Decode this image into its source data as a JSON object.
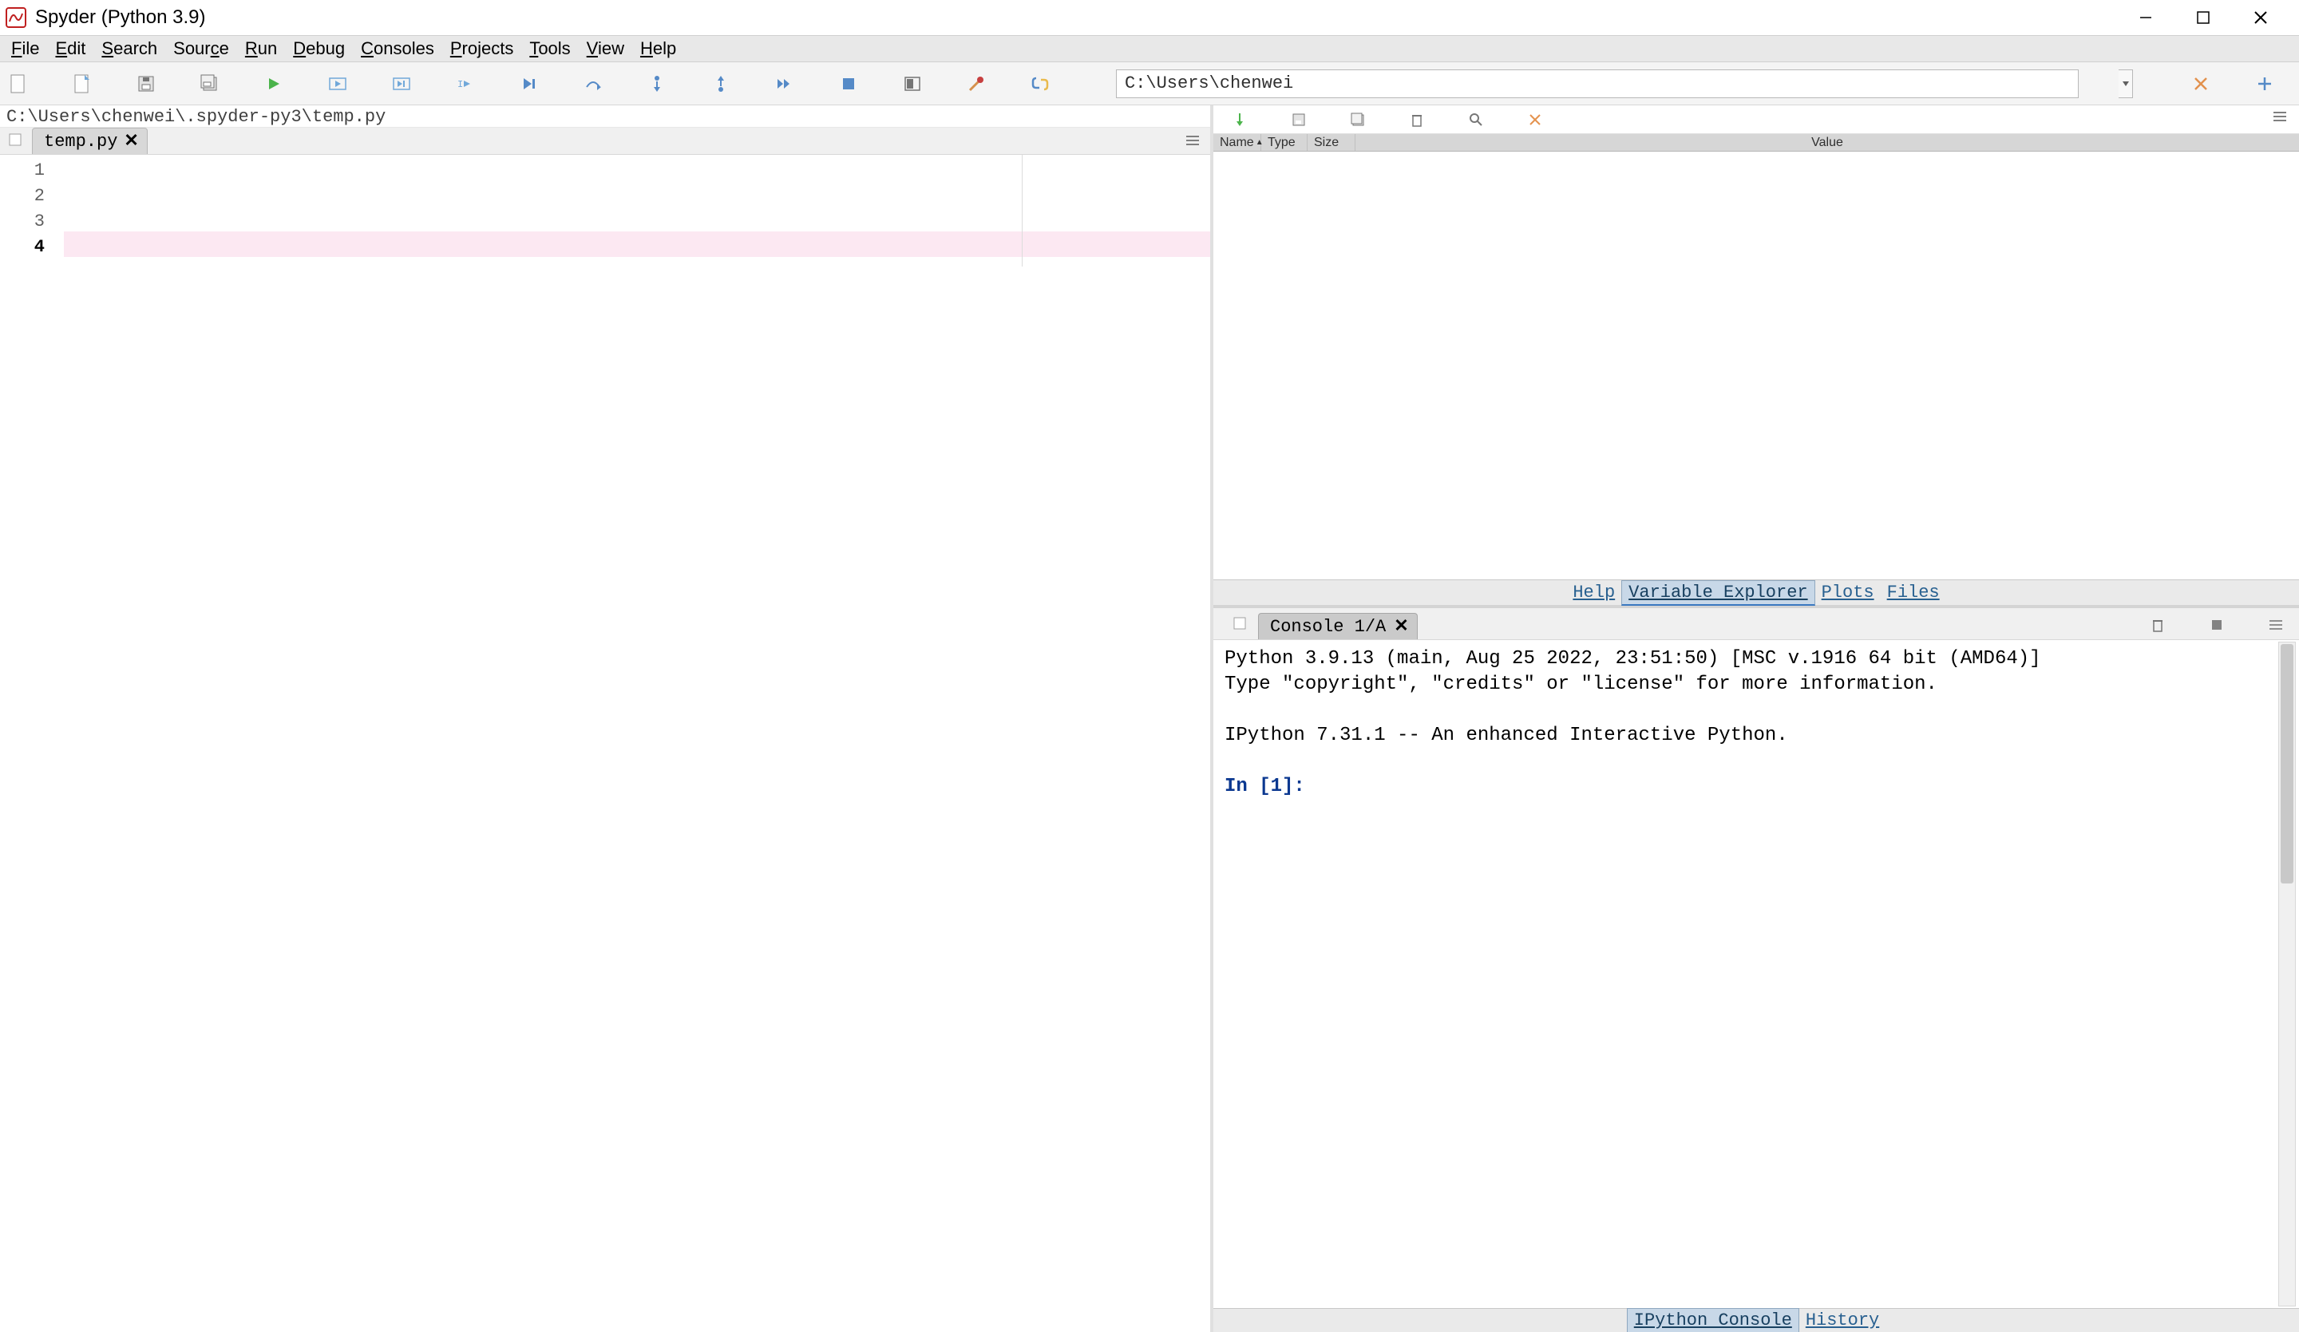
{
  "window": {
    "title": "Spyder (Python 3.9)"
  },
  "menu": {
    "items": [
      {
        "pre": "",
        "u": "F",
        "post": "ile"
      },
      {
        "pre": "",
        "u": "E",
        "post": "dit"
      },
      {
        "pre": "",
        "u": "S",
        "post": "earch"
      },
      {
        "pre": "Sour",
        "u": "c",
        "post": "e"
      },
      {
        "pre": "",
        "u": "R",
        "post": "un"
      },
      {
        "pre": "",
        "u": "D",
        "post": "ebug"
      },
      {
        "pre": "",
        "u": "C",
        "post": "onsoles"
      },
      {
        "pre": "",
        "u": "P",
        "post": "rojects"
      },
      {
        "pre": "",
        "u": "T",
        "post": "ools"
      },
      {
        "pre": "",
        "u": "V",
        "post": "iew"
      },
      {
        "pre": "",
        "u": "H",
        "post": "elp"
      }
    ]
  },
  "toolbar": {
    "working_dir": "C:\\Users\\chenwei"
  },
  "editor": {
    "filepath": "C:\\Users\\chenwei\\.spyder-py3\\temp.py",
    "tab": "temp.py",
    "lines": [
      "1",
      "2",
      "3",
      "4"
    ],
    "current_line_index": 3
  },
  "var_explorer": {
    "cols": {
      "name": "Name",
      "type": "Type",
      "size": "Size",
      "value": "Value"
    }
  },
  "right_tabs": {
    "help": "Help",
    "var": "Variable Explorer",
    "plots": "Plots",
    "files": "Files"
  },
  "console": {
    "tab": "Console 1/A",
    "line1": "Python 3.9.13 (main, Aug 25 2022, 23:51:50) [MSC v.1916 64 bit (AMD64)]",
    "line2": "Type \"copyright\", \"credits\" or \"license\" for more information.",
    "line3": "IPython 7.31.1 -- An enhanced Interactive Python.",
    "prompt": "In [1]:"
  },
  "console_tabs": {
    "ipy": "IPython Console",
    "hist": "History"
  }
}
